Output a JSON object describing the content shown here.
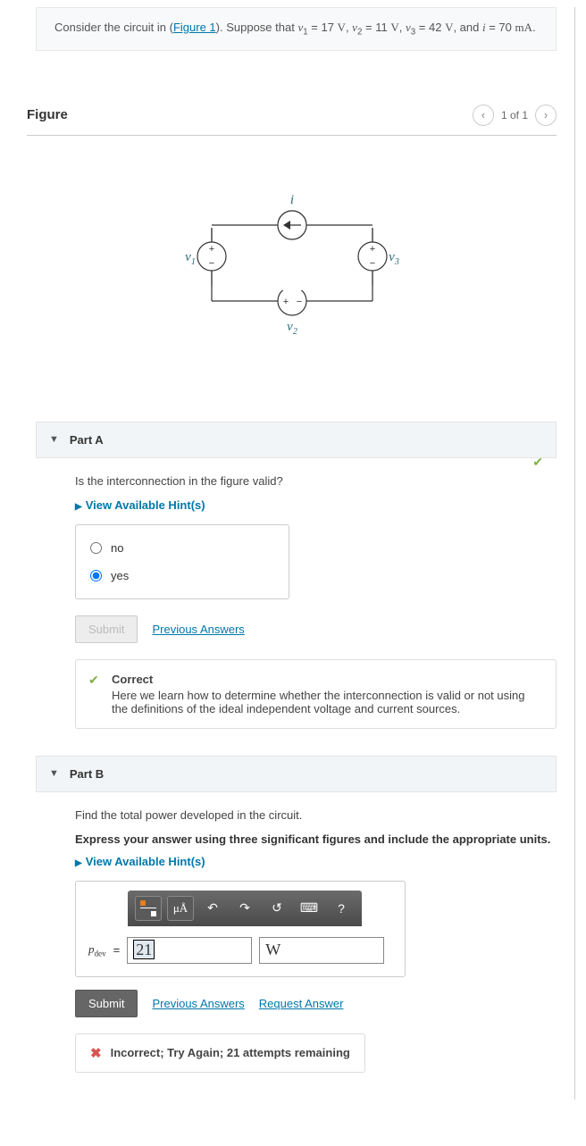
{
  "problem": {
    "prefix": "Consider the circuit in (",
    "figure_link": "Figure 1",
    "suffix_intro": "). Suppose that ",
    "v1_label": "v",
    "v1_sub": "1",
    "v1_eq": " = 17 ",
    "v1_unit": "V",
    "sep1": ", ",
    "v2_label": "v",
    "v2_sub": "2",
    "v2_eq": " = 11 ",
    "v2_unit": "V",
    "sep2": ", ",
    "v3_label": "v",
    "v3_sub": "3",
    "v3_eq": " = 42 ",
    "v3_unit": "V",
    "sep3": ", and ",
    "i_label": "i",
    "i_eq": " = 70 ",
    "i_unit": "mA",
    "period": "."
  },
  "figure": {
    "title": "Figure",
    "pager": "1 of 1",
    "labels": {
      "i": "i",
      "v1": "v",
      "v1s": "1",
      "v2": "v",
      "v2s": "2",
      "v3": "v",
      "v3s": "3"
    }
  },
  "partA": {
    "title": "Part A",
    "question": "Is the interconnection in the figure valid?",
    "hints": "View Available Hint(s)",
    "opt_no": "no",
    "opt_yes": "yes",
    "submit": "Submit",
    "prev": "Previous Answers",
    "fb_title": "Correct",
    "fb_body": "Here we learn how to determine whether the interconnection is valid or not using the definitions of the ideal independent voltage and current sources."
  },
  "partB": {
    "title": "Part B",
    "question": "Find the total power developed in the circuit.",
    "instruction": "Express your answer using three significant figures and include the appropriate units.",
    "hints": "View Available Hint(s)",
    "pdev_sym": "p",
    "pdev_sub": "dev",
    "eq": " = ",
    "value": "21",
    "unit": "W",
    "toolbar_units_label": "μÅ",
    "submit": "Submit",
    "prev": "Previous Answers",
    "req": "Request Answer",
    "incorrect": "Incorrect; Try Again; 21 attempts remaining"
  },
  "chart_data": {
    "type": "diagram",
    "description": "Electrical circuit with four ideal sources connected in a single loop",
    "elements": [
      {
        "name": "v1",
        "type": "voltage_source",
        "position": "left",
        "polarity": "+ top, - bottom",
        "value_V": 17
      },
      {
        "name": "v2",
        "type": "voltage_source",
        "position": "bottom",
        "polarity": "+ left, - right",
        "value_V": 11
      },
      {
        "name": "v3",
        "type": "voltage_source",
        "position": "right",
        "polarity": "+ top, - bottom",
        "value_V": 42
      },
      {
        "name": "i",
        "type": "current_source",
        "position": "top",
        "direction": "right_to_left",
        "value_mA": 70
      }
    ],
    "loop_order": [
      "v1",
      "i",
      "v3",
      "v2"
    ]
  }
}
